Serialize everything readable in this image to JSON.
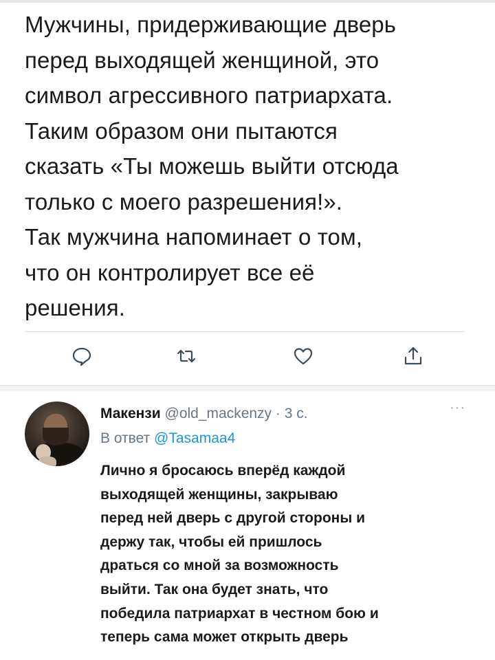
{
  "tweet": {
    "text_lines": [
      "Мужчины, придерживающие дверь",
      "перед выходящей женщиной, это",
      "символ агрессивного патриархата.",
      "Таким образом они пытаются",
      "сказать «Ты можешь выйти отсюда",
      "только с моего разрешения!».",
      "Так мужчина напоминает о том,",
      "что он контролирует все её",
      "решения."
    ]
  },
  "actions": [
    {
      "icon": "reply-icon"
    },
    {
      "icon": "retweet-icon"
    },
    {
      "icon": "like-icon"
    },
    {
      "icon": "share-icon"
    }
  ],
  "reply": {
    "author_name": "Макензи",
    "author_handle": "@old_mackenzy",
    "separator": " · ",
    "time": "3 с.",
    "more_label": "···",
    "reply_to_prefix": "В ответ ",
    "reply_to_mention": "@Tasamaa4",
    "text_lines": [
      "Лично я бросаюсь вперёд каждой",
      "выходящей женщины, закрываю",
      "перед ней дверь с другой стороны и",
      "держу так, чтобы ей пришлось",
      "драться со мной за возможность",
      "выйти. Так она будет знать, что",
      "победила патриархат в честном бою и",
      "теперь сама может открыть дверь"
    ]
  },
  "colors": {
    "text": "#14171a",
    "muted": "#657786",
    "link": "#1b95e0",
    "icon": "#3b4b57"
  }
}
